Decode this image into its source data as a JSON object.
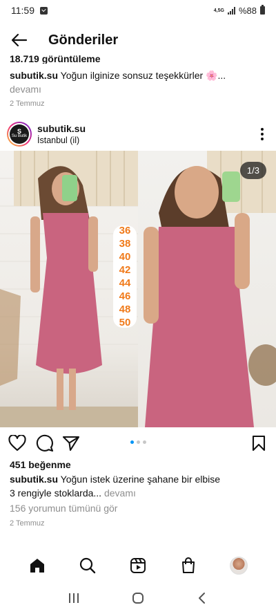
{
  "status_bar": {
    "time": "11:59",
    "network_label": "4,5G",
    "battery": "%88"
  },
  "header": {
    "title": "Gönderiler"
  },
  "previous_post": {
    "views": "18.719 görüntüleme",
    "username": "subutik.su",
    "caption": "Yoğun ilginize sonsuz teşekkürler 🌸...",
    "more": "devamı",
    "date": "2 Temmuz"
  },
  "post": {
    "username": "subutik.su",
    "location": "İstanbul (il)",
    "avatar_text": "Su Butik",
    "counter": "1/3",
    "sizes": [
      "36",
      "38",
      "40",
      "42",
      "44",
      "46",
      "48",
      "50"
    ],
    "likes": "451 beğenme",
    "caption_line1": "Yoğun istek üzerine şahane bir elbise",
    "caption_line2": "3 rengiyle stoklarda...",
    "more": "devamı",
    "comments_link": "156 yorumun tümünü gör",
    "date": "2 Temmuz",
    "dress_color": "#c9647f",
    "size_text_color": "#f07a1a"
  },
  "carousel": {
    "total": 3,
    "active": 0,
    "active_color": "#0095f6"
  },
  "icons": {
    "back": "arrow-left-icon",
    "more": "kebab-icon",
    "like": "heart-icon",
    "comment": "comment-icon",
    "share": "send-icon",
    "save": "bookmark-icon",
    "home": "home-icon",
    "search": "search-icon",
    "reels": "reels-icon",
    "shop": "shop-icon"
  }
}
